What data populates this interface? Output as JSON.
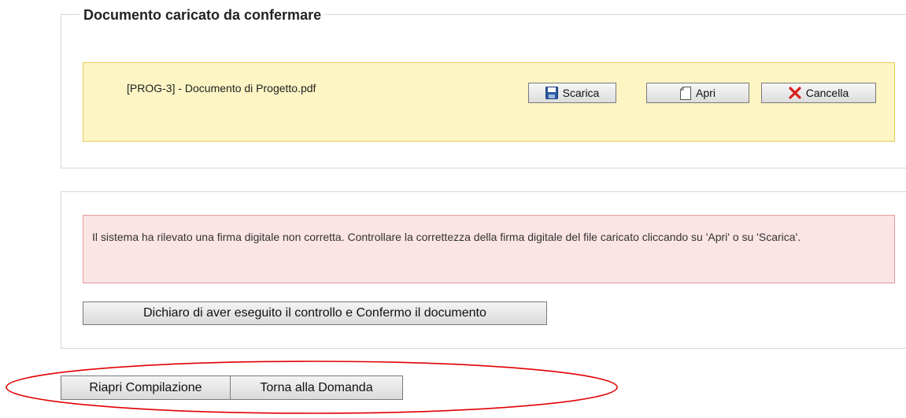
{
  "document_section": {
    "legend": "Documento caricato da confermare",
    "file_name": "[PROG-3] - Documento di Progetto.pdf",
    "buttons": {
      "download_label": "Scarica",
      "open_label": "Apri",
      "delete_label": "Cancella"
    },
    "icons": {
      "download": "floppy-disk-icon",
      "open": "document-icon",
      "delete": "red-x-icon"
    }
  },
  "verification_section": {
    "error_message": "Il sistema ha rilevato una firma digitale non corretta. Controllare la correttezza della firma digitale del file caricato cliccando su 'Apri' o su 'Scarica'.",
    "confirm_button_label": "Dichiaro di aver eseguito il controllo e Confermo il documento"
  },
  "footer_actions": {
    "reopen_label": "Riapri Compilazione",
    "back_label": "Torna alla Domanda"
  },
  "colors": {
    "doc_box_bg": "#fdf5c4",
    "doc_box_border": "#e8cc5b",
    "error_bg": "#fbe4e4",
    "error_border": "#e89a9a",
    "annotation_ellipse": "#e00000"
  }
}
